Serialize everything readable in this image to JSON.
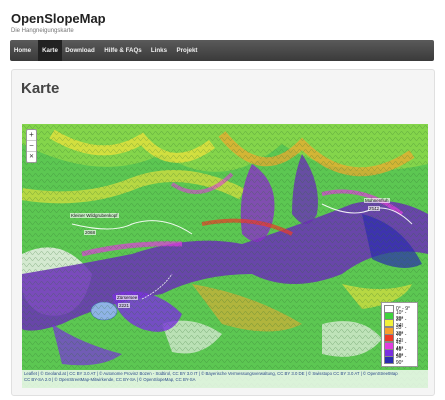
{
  "site": {
    "title": "OpenSlopeMap",
    "subtitle": "Die Hangneigungskarte"
  },
  "nav": {
    "items": [
      {
        "label": "Home",
        "active": false
      },
      {
        "label": "Karte",
        "active": true
      },
      {
        "label": "Download",
        "active": false
      },
      {
        "label": "Hilfe & FAQs",
        "active": false
      },
      {
        "label": "Links",
        "active": false
      },
      {
        "label": "Projekt",
        "active": false
      }
    ]
  },
  "card": {
    "title": "Karte"
  },
  "map": {
    "zoom_in": "+",
    "zoom_out": "−",
    "fullscreen": "✕",
    "places": [
      {
        "label": "Kleiner Wildgrubenkopf"
      },
      {
        "label": "2068"
      },
      {
        "label": "Mohnenfluh"
      },
      {
        "label": "2542"
      },
      {
        "label": "Zürsersee"
      },
      {
        "label": "2221"
      }
    ],
    "legend": [
      {
        "label": "0° - 9°",
        "color": "#ffffff"
      },
      {
        "label": "10° - 29°",
        "color": "#3ed43c"
      },
      {
        "label": "30° - 34°",
        "color": "#f2f23a"
      },
      {
        "label": "35° - 39°",
        "color": "#f7a12c"
      },
      {
        "label": "40° - 42°",
        "color": "#ee3a26"
      },
      {
        "label": "42° - 45°",
        "color": "#e23ce0"
      },
      {
        "label": "45° - 49°",
        "color": "#7a2fe0"
      },
      {
        "label": "50° - 90°",
        "color": "#2b2bb0"
      }
    ],
    "attribution_line1": "Leaflet | © Geoland.at | CC BY 3.0 AT | © Autonome Provinz Bozen - Südtirol, CC BY 3.0 IT | © Bayerische Vermessungsverwaltung, CC BY 3.0 DE | © Swisstopo CC BY 3.0 AT | © OpenStreetMap",
    "attribution_line2": "CC BY-SA 2.0 | © OpenStreetMap-Mitwirkende, CC BY-SA | © OpenSlopeMap, CC BY-SA"
  }
}
